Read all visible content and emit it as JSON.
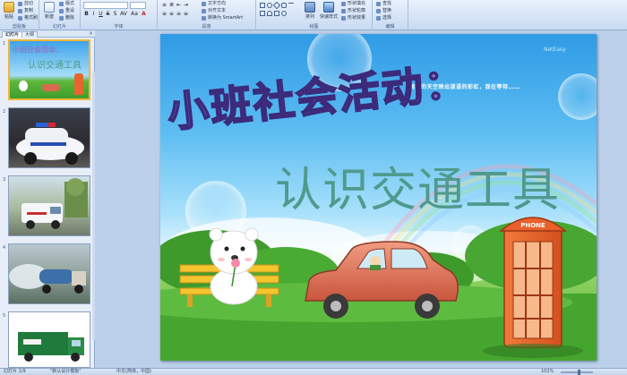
{
  "ribbon": {
    "clipboard": {
      "label": "剪贴板",
      "paste": "粘贴",
      "cut": "剪切",
      "copy": "复制",
      "format_painter": "格式刷"
    },
    "slides": {
      "label": "幻灯片",
      "new_slide": "新建",
      "layout": "版式",
      "reset": "重设",
      "delete": "删除"
    },
    "font": {
      "label": "字体",
      "font_name": "",
      "font_size": "",
      "bold": "B",
      "italic": "I",
      "underline": "U",
      "strike": "S",
      "shadow": "S",
      "spacing": "AV",
      "case": "Aa",
      "color": "A"
    },
    "paragraph": {
      "label": "段落",
      "text_direction": "文字方向",
      "align_text": "对齐文本",
      "smartart": "转换为 SmartArt"
    },
    "drawing": {
      "label": "绘图",
      "arrange": "排列",
      "quick_styles": "快速样式",
      "shape_fill": "形状填充",
      "shape_outline": "形状轮廓",
      "shape_effects": "形状效果"
    },
    "editing": {
      "label": "编辑",
      "find": "查找",
      "replace": "替换",
      "select": "选择"
    }
  },
  "left_pane": {
    "tab_slides": "幻灯片",
    "tab_outline": "大纲",
    "close": "×",
    "thumbnails": [
      {
        "number": "1"
      },
      {
        "number": "2"
      },
      {
        "number": "3"
      },
      {
        "number": "4"
      },
      {
        "number": "5"
      }
    ]
  },
  "slide": {
    "title_main": "小班社会活动：",
    "title_sub": "认识交通工具",
    "caption": "雨后的天空映出谜语的彩虹，我在等待……",
    "watermark": "NetEasy",
    "booth_sign": "PHONE",
    "thumb1_title": "小班社会活动：",
    "thumb1_sub": "认识交通工具"
  },
  "status": {
    "slide_of": "幻灯片 1/9",
    "theme": "\"默认设计模板\"",
    "language": "中文(简体，中国)",
    "zoom": "102%"
  },
  "colors": {
    "ribbon_bg": "#c9dbf2",
    "workspace_bg": "#bcd0ea",
    "title_purple": "#8a79c8",
    "subtitle_teal": "#4f9a8c",
    "phone_booth": "#e8652d",
    "car_red": "#d96a4e"
  },
  "icons": {
    "paste": "paste-icon",
    "new_slide": "new-slide-icon",
    "find": "search-icon",
    "close": "close-icon"
  }
}
